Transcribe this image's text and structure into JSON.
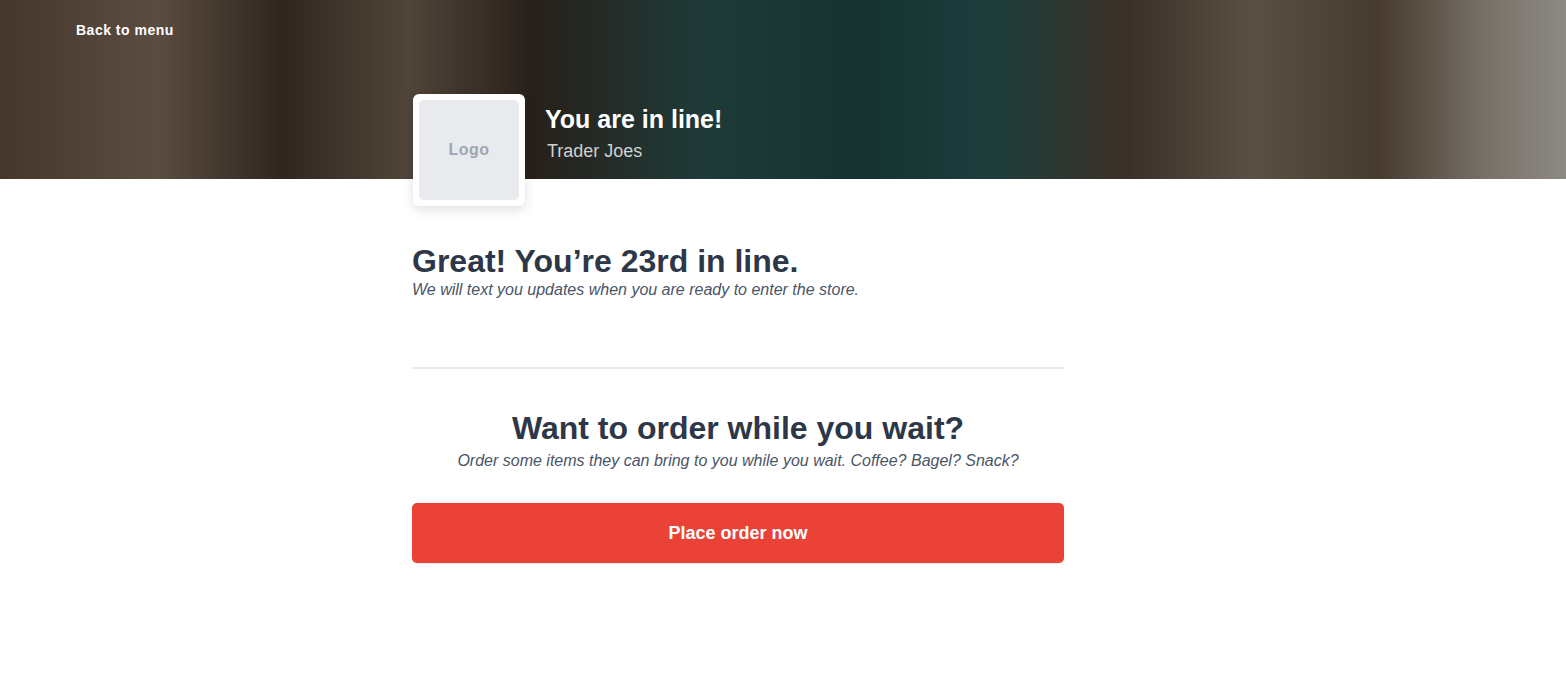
{
  "back_link": "Back to menu",
  "header": {
    "title": "You are in line!",
    "store": "Trader Joes",
    "logo": "Logo"
  },
  "status": {
    "headline": "Great! You’re 23rd in line.",
    "note": "We will text you updates when you are ready to enter the store."
  },
  "order_prompt": {
    "title": "Want to order while you wait?",
    "text": "Order some items they can bring to you while you wait. Coffee? Bagel? Snack?"
  },
  "button": "Place order now"
}
